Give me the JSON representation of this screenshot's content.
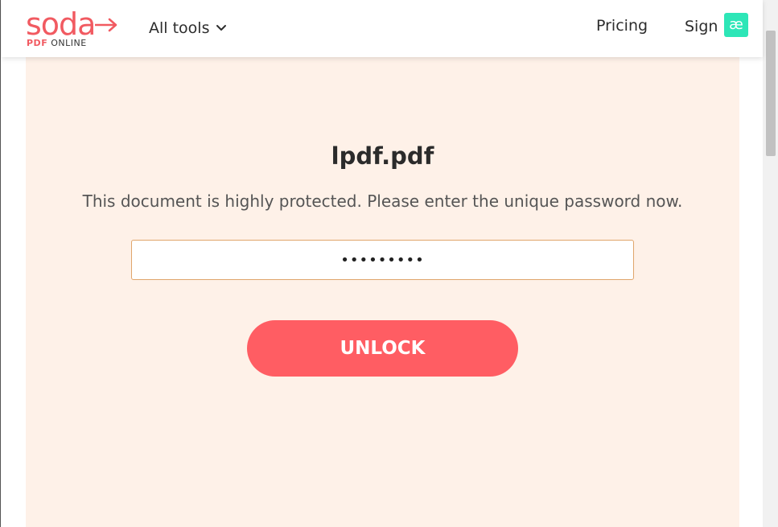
{
  "header": {
    "logo_word": "soda",
    "logo_sub_brand": "PDF",
    "logo_sub_text": "ONLINE",
    "all_tools_label": "All tools",
    "pricing_label": "Pricing",
    "signin_label": "Sign in",
    "extension_badge_text": "æ"
  },
  "unlock_panel": {
    "filename": "lpdf.pdf",
    "message": "This document is highly protected. Please enter the unique password now.",
    "password_value": "•••••••••",
    "unlock_label": "UNLOCK"
  },
  "colors": {
    "brand": "#f15a61",
    "button": "#ff5d63",
    "panel_background": "#fef1e8",
    "input_border": "#e0a56b",
    "extension_badge": "#2de6b7"
  },
  "icons": {
    "logo_arrow": "arrow-right-icon",
    "all_tools_chevron": "chevron-down-icon",
    "extension": "extension-badge-icon"
  }
}
